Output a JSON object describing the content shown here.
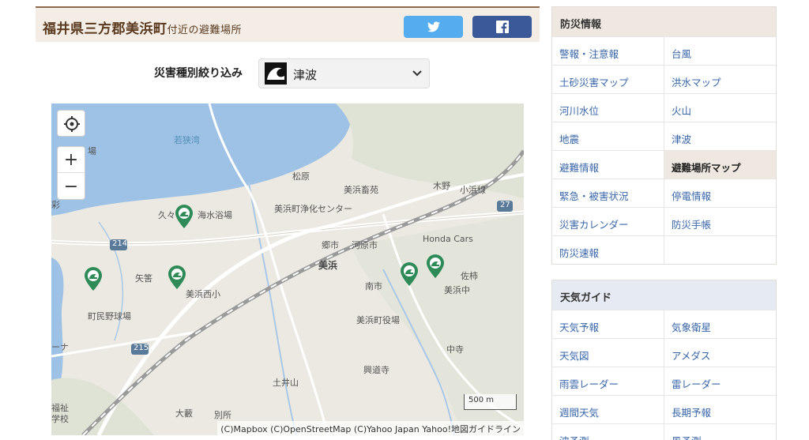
{
  "header": {
    "title_main": "福井県三方郡美浜町",
    "title_suffix": "付近の避難場所",
    "twitter_icon": "twitter-bird-icon",
    "facebook_icon": "facebook-f-icon"
  },
  "filter": {
    "label": "災害種別絞り込み",
    "selected": "津波",
    "selected_icon": "tsunami-wave-icon"
  },
  "map": {
    "labels": {
      "wakasa_bay": "若狭湾",
      "matsubara": "松原",
      "mihama_chikusan": "美浜畜苑",
      "kino": "木野",
      "obama_line": "小浜線",
      "route27": "27",
      "kukushi": "久々子",
      "kaisuiyokujo": "海水浴場",
      "jokasen": "美浜町浄化センター",
      "route214": "214",
      "goichi": "郷市",
      "kawaharaichi": "河原市",
      "honda": "Honda Cars",
      "mihama_station": "美浜",
      "yaha": "矢筈",
      "minamiichi": "南市",
      "sagaki": "佐柿",
      "mihama_nishi": "美浜西小",
      "mihama_chu": "美浜中",
      "town_ballpark": "町民野球場",
      "town_hall": "美浜町役場",
      "route215": "215",
      "nakadera": "中寺",
      "kogudoji": "興道寺",
      "tsuiyama": "土井山",
      "okura": "大藪",
      "bessho": "別所",
      "welfare": "福祉",
      "school": "学校",
      "left_edge_ta": "場",
      "left_edge_mid": "ーナ",
      "left_kagami": "彩"
    },
    "scale_label": "500 m",
    "attribution": "(C)Mapbox (C)OpenStreetMap (C)Yahoo Japan Yahoo!地図ガイドライン",
    "controls": {
      "locate_icon": "crosshair-locate-icon",
      "zoom_in": "+",
      "zoom_out": "−"
    },
    "colors": {
      "water": "#9ec1e6",
      "land": "#ebe9e2",
      "pin": "#2e8b57",
      "rail": "#888888"
    }
  },
  "sidebar": {
    "bousai": {
      "title": "防災情報",
      "items": [
        "警報・注意報",
        "台風",
        "土砂災害マップ",
        "洪水マップ",
        "河川水位",
        "火山",
        "地震",
        "津波",
        "避難情報",
        "避難場所マップ",
        "緊急・被害状況",
        "停電情報",
        "災害カレンダー",
        "防災手帳",
        "防災速報",
        ""
      ],
      "active": "避難場所マップ"
    },
    "tenki": {
      "title": "天気ガイド",
      "items": [
        "天気予報",
        "気象衛星",
        "天気図",
        "アメダス",
        "雨雲レーダー",
        "雷レーダー",
        "週間天気",
        "長期予報",
        "波予測",
        "風予測"
      ]
    }
  }
}
